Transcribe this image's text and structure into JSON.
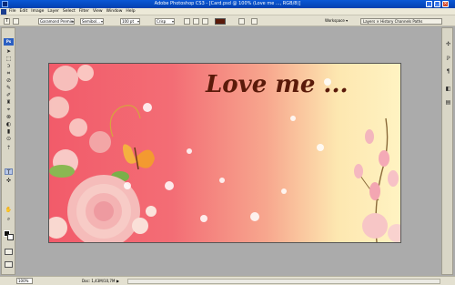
{
  "window": {
    "title": "Adobe Photoshop CS3 - [Card.psd @ 100% (Love me ..., RGB/8)]",
    "minimize": "_",
    "maximize": "□",
    "close": "×"
  },
  "menubar": {
    "items": [
      "File",
      "Edit",
      "Image",
      "Layer",
      "Select",
      "Filter",
      "View",
      "Window",
      "Help"
    ]
  },
  "options": {
    "tool_glyph": "T",
    "font_family": "Garamond Premie...",
    "font_style": "Semibol...",
    "font_size": "100 pt",
    "antialias": "Crisp",
    "text_color": "#5a1a0a",
    "workspace": "Workspace ▾",
    "palette_tabs": "Layers × History Channels Paths"
  },
  "toolbox": {
    "badge": "Ps",
    "tools": [
      "➤",
      "⬚",
      "ↄ",
      "⌗",
      "⊘",
      "✎",
      "✐",
      "♜",
      "⌖",
      "⊗",
      "◐",
      "▮",
      "⊙",
      "⇡",
      "T",
      "✜",
      "✋",
      "⌕"
    ]
  },
  "dock": {
    "icons": [
      "✣",
      "ℙ",
      "¶",
      "◧",
      "▤"
    ]
  },
  "document": {
    "text": "Love me ..."
  },
  "status": {
    "zoom": "100%",
    "doc_info": "Doc: 1,43M/10,7M",
    "arrow": "▶"
  }
}
